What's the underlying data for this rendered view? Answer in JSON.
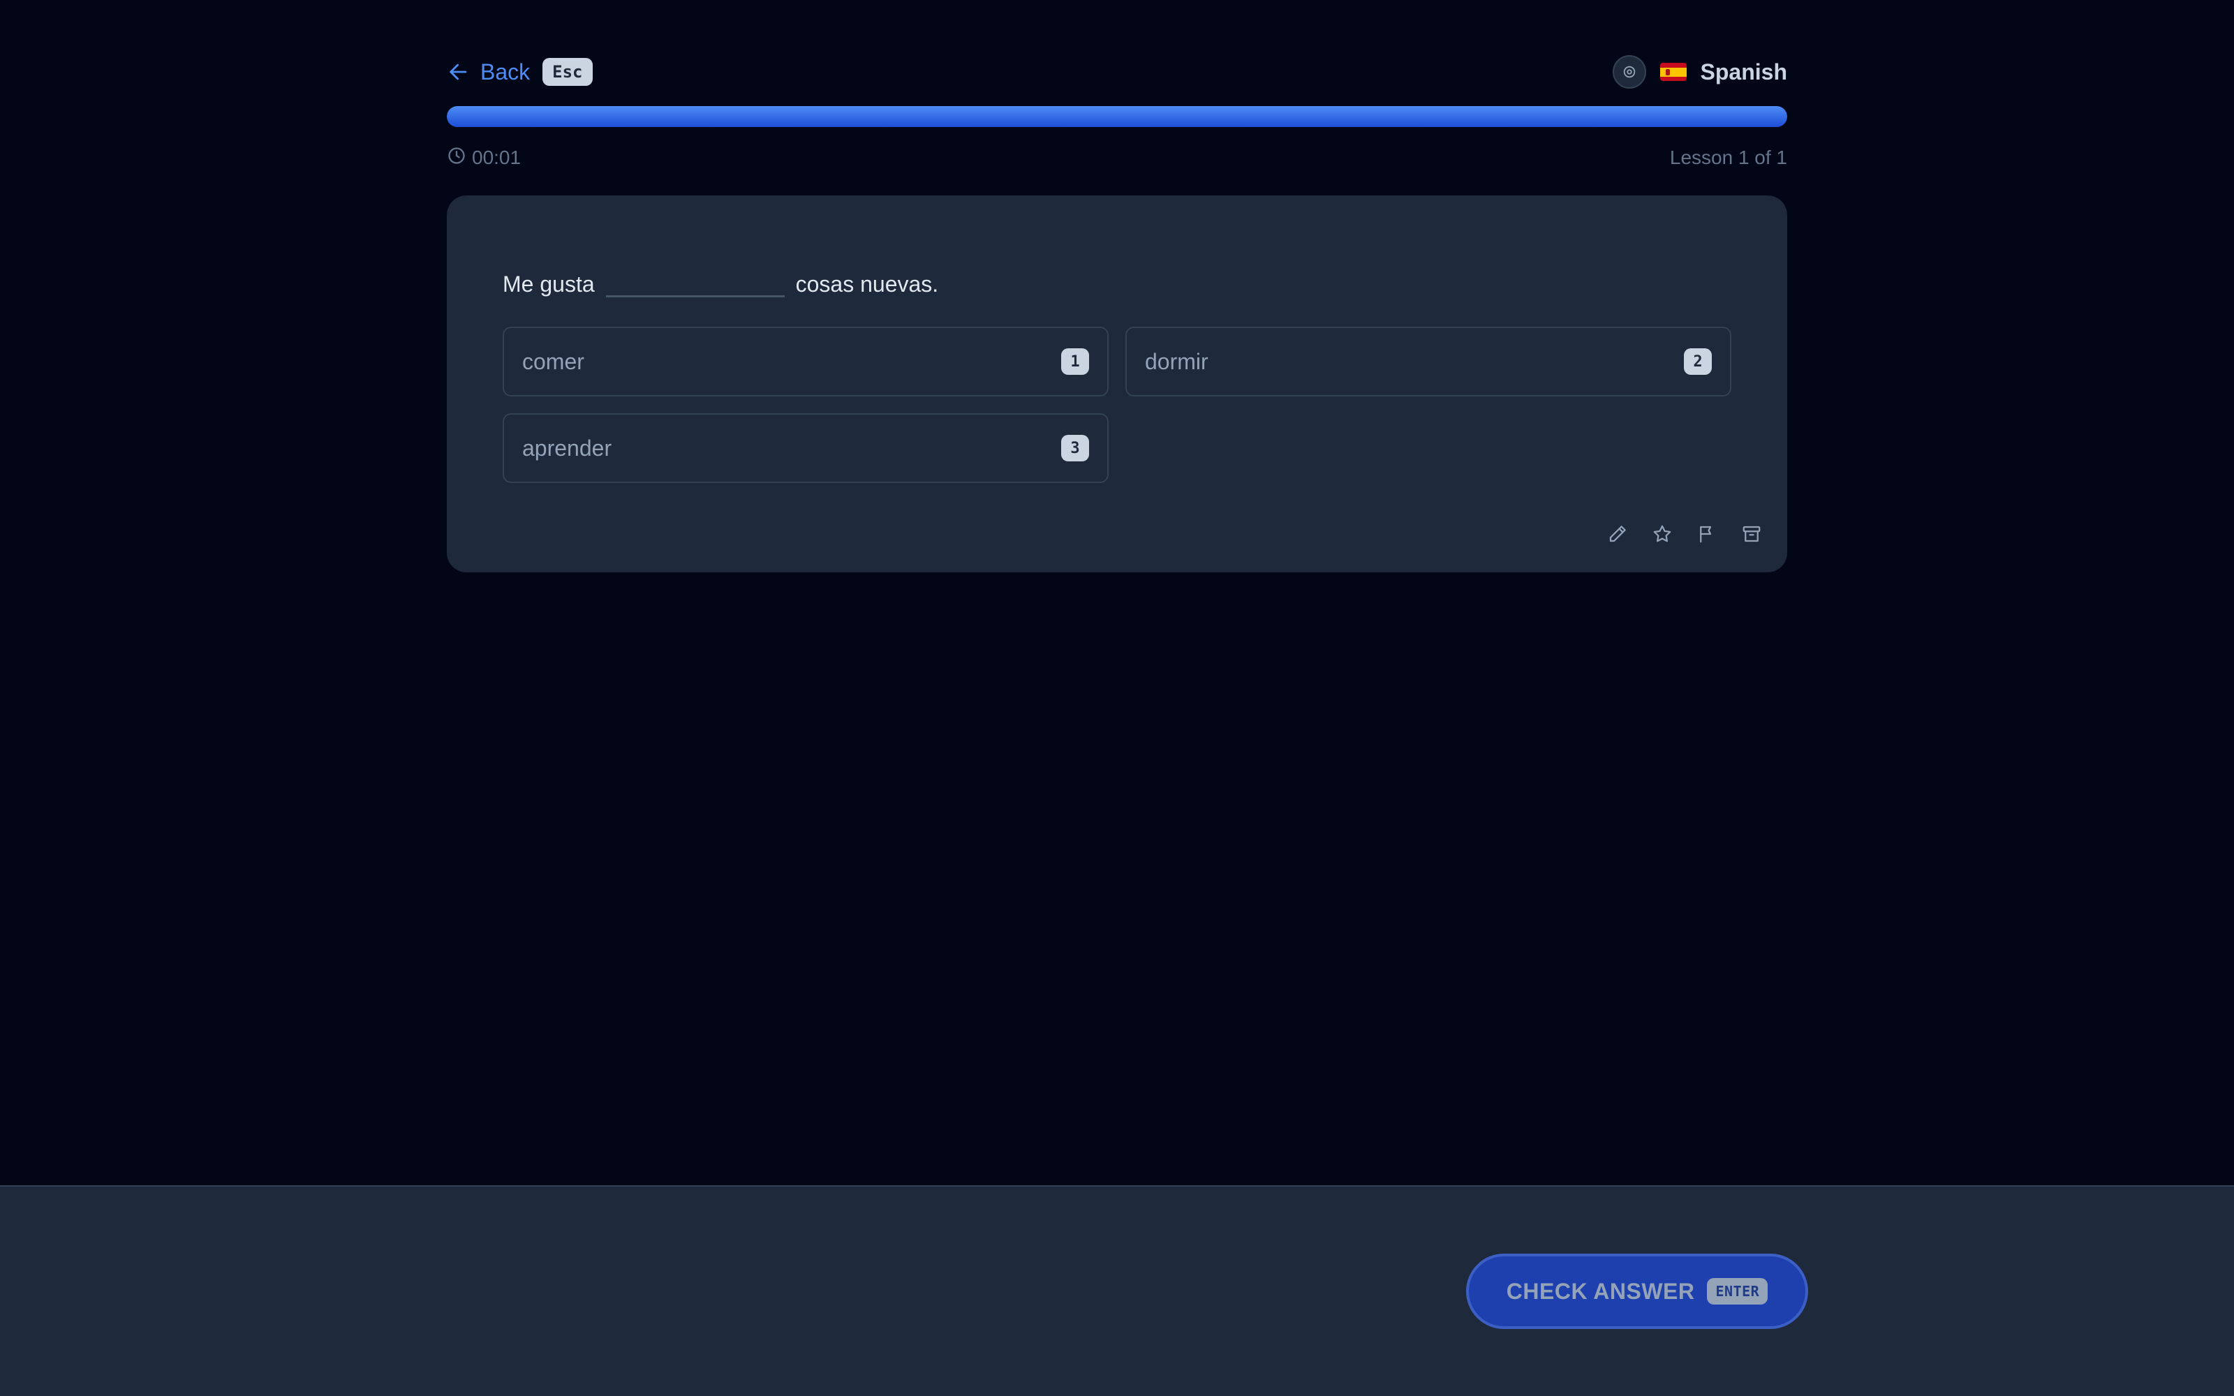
{
  "header": {
    "back_label": "Back",
    "back_shortcut": "Esc",
    "language": "Spanish",
    "language_icon": "settings-icon",
    "flag": "spain-flag-icon"
  },
  "progress": {
    "fraction": 1.0
  },
  "meta": {
    "timer": "00:01",
    "lesson": "Lesson 1 of 1"
  },
  "question": {
    "before": "Me gusta",
    "after": "cosas nuevas."
  },
  "options": [
    {
      "label": "comer",
      "key": "1"
    },
    {
      "label": "dormir",
      "key": "2"
    },
    {
      "label": "aprender",
      "key": "3"
    }
  ],
  "tools": [
    "pencil-icon",
    "star-icon",
    "flag-icon",
    "archive-icon"
  ],
  "footer": {
    "check_label": "CHECK ANSWER",
    "check_shortcut": "ENTER"
  },
  "colors": {
    "background": "#020617",
    "card": "#1e293b",
    "accent": "#4f8df6",
    "button": "#1e40af"
  }
}
